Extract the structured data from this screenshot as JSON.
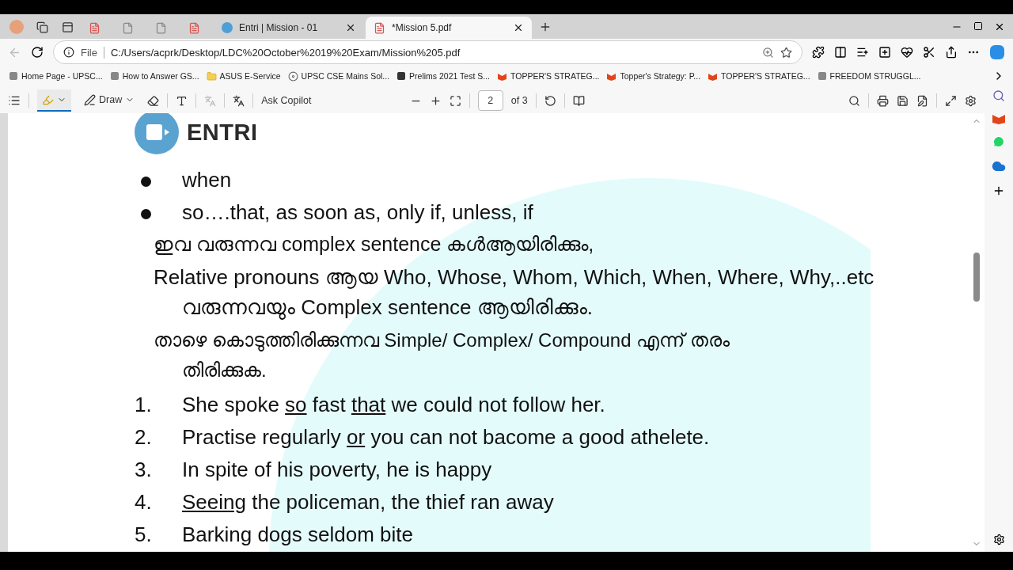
{
  "tabs": [
    {
      "kind": "pinned",
      "selected": false
    },
    {
      "kind": "pinned",
      "selected": false
    },
    {
      "kind": "pinned",
      "selected": false
    },
    {
      "kind": "pinned",
      "selected": false
    },
    {
      "kind": "full",
      "title": "Entri | Mission - 01",
      "selected": false
    },
    {
      "kind": "full",
      "title": "*Mission 5.pdf",
      "selected": true
    }
  ],
  "address": {
    "scheme": "File",
    "url": "C:/Users/acprk/Desktop/LDC%20October%2019%20Exam/Mission%205.pdf"
  },
  "bookmarks": [
    "Home Page - UPSC...",
    "How to Answer GS...",
    "ASUS E-Service",
    "UPSC CSE Mains Sol...",
    "Prelims 2021 Test S...",
    "TOPPER'S STRATEG...",
    "Topper's Strategy: P...",
    "TOPPER'S STRATEG...",
    "FREEDOM STRUGGL..."
  ],
  "pdf_toolbar": {
    "highlight_selected": true,
    "draw": "Draw",
    "copilot": "Ask Copilot",
    "page": "2",
    "page_count": "of 3"
  },
  "document": {
    "brand": "ENTRI",
    "bullets": [
      "when",
      "so….that, as soon as, only if, unless, if"
    ],
    "notes": [
      "ഇവ വരുന്നവ complex sentence കൾആയിരിക്കും,",
      "Relative pronouns ആയ Who, Whose, Whom, Which, When, Where, Why,..etc വരുന്നവയും Complex sentence ആയിരിക്കും.",
      "താഴെ കൊടുത്തിരിക്കുന്നവ Simple/ Complex/ Compound എന്ന് തരം തിരിക്കുക."
    ],
    "items": [
      {
        "number": "1.",
        "parts": [
          {
            "text": "She spoke "
          },
          {
            "text": "so",
            "underlined": true
          },
          {
            "text": " fast "
          },
          {
            "text": "that",
            "underlined": true
          },
          {
            "text": " we could not follow her."
          }
        ]
      },
      {
        "number": "2.",
        "parts": [
          {
            "text": "Practise regularly "
          },
          {
            "text": "or",
            "underlined": true
          },
          {
            "text": " you can not bacome a good athelete."
          }
        ]
      },
      {
        "number": "3.",
        "parts": [
          {
            "text": "In spite of his poverty, he is happy"
          }
        ]
      },
      {
        "number": "4.",
        "parts": [
          {
            "text": "Seeing",
            "underlined": true
          },
          {
            "text": " the policeman, the thief ran away"
          }
        ]
      },
      {
        "number": "5.",
        "parts": [
          {
            "text": "Barking dogs seldom bite"
          }
        ]
      }
    ]
  }
}
